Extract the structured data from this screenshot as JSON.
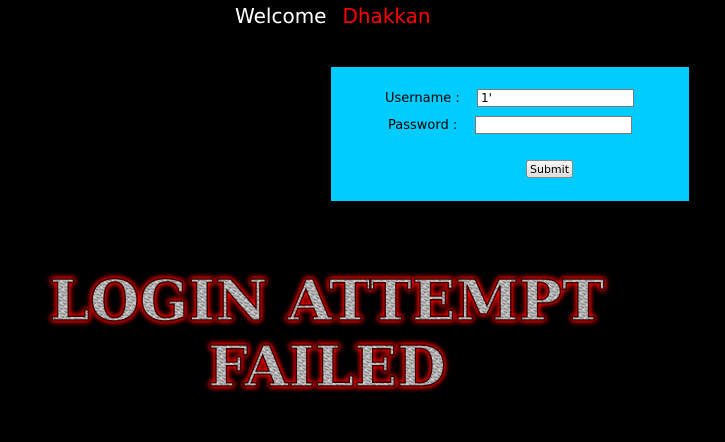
{
  "header": {
    "welcome_label": "Welcome",
    "user_name": "Dhakkan",
    "welcome_color": "#ffffff",
    "name_color": "#ff0000"
  },
  "login_form": {
    "background": "#00ccff",
    "username_label": "Username :",
    "username_value": "1'",
    "password_label": "Password :",
    "password_value": "",
    "submit_label": "Submit"
  },
  "result_image": {
    "line1": "LOGIN ATTEMPT",
    "line2": "FAILED",
    "glow_color": "#ff0000"
  }
}
